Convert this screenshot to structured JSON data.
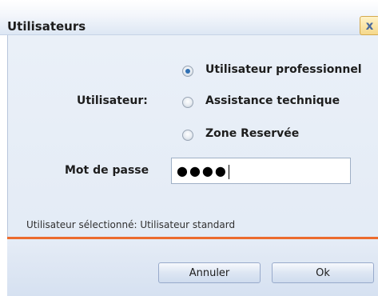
{
  "window": {
    "title": "Utilisateurs",
    "close_glyph": "x"
  },
  "form": {
    "user_label": "Utilisateur:",
    "options": [
      {
        "label": "Utilisateur professionnel",
        "checked": true
      },
      {
        "label": "Assistance technique",
        "checked": false
      },
      {
        "label": "Zone Reservée",
        "checked": false
      }
    ],
    "password_label": "Mot de passe",
    "password_value": "●●●●"
  },
  "status": {
    "text": "Utilisateur sélectionné: Utilisateur standard"
  },
  "buttons": {
    "cancel": "Annuler",
    "ok": "Ok"
  },
  "colors": {
    "accent_line": "#ec6c2e",
    "radio_selected": "#2f6fb3"
  }
}
